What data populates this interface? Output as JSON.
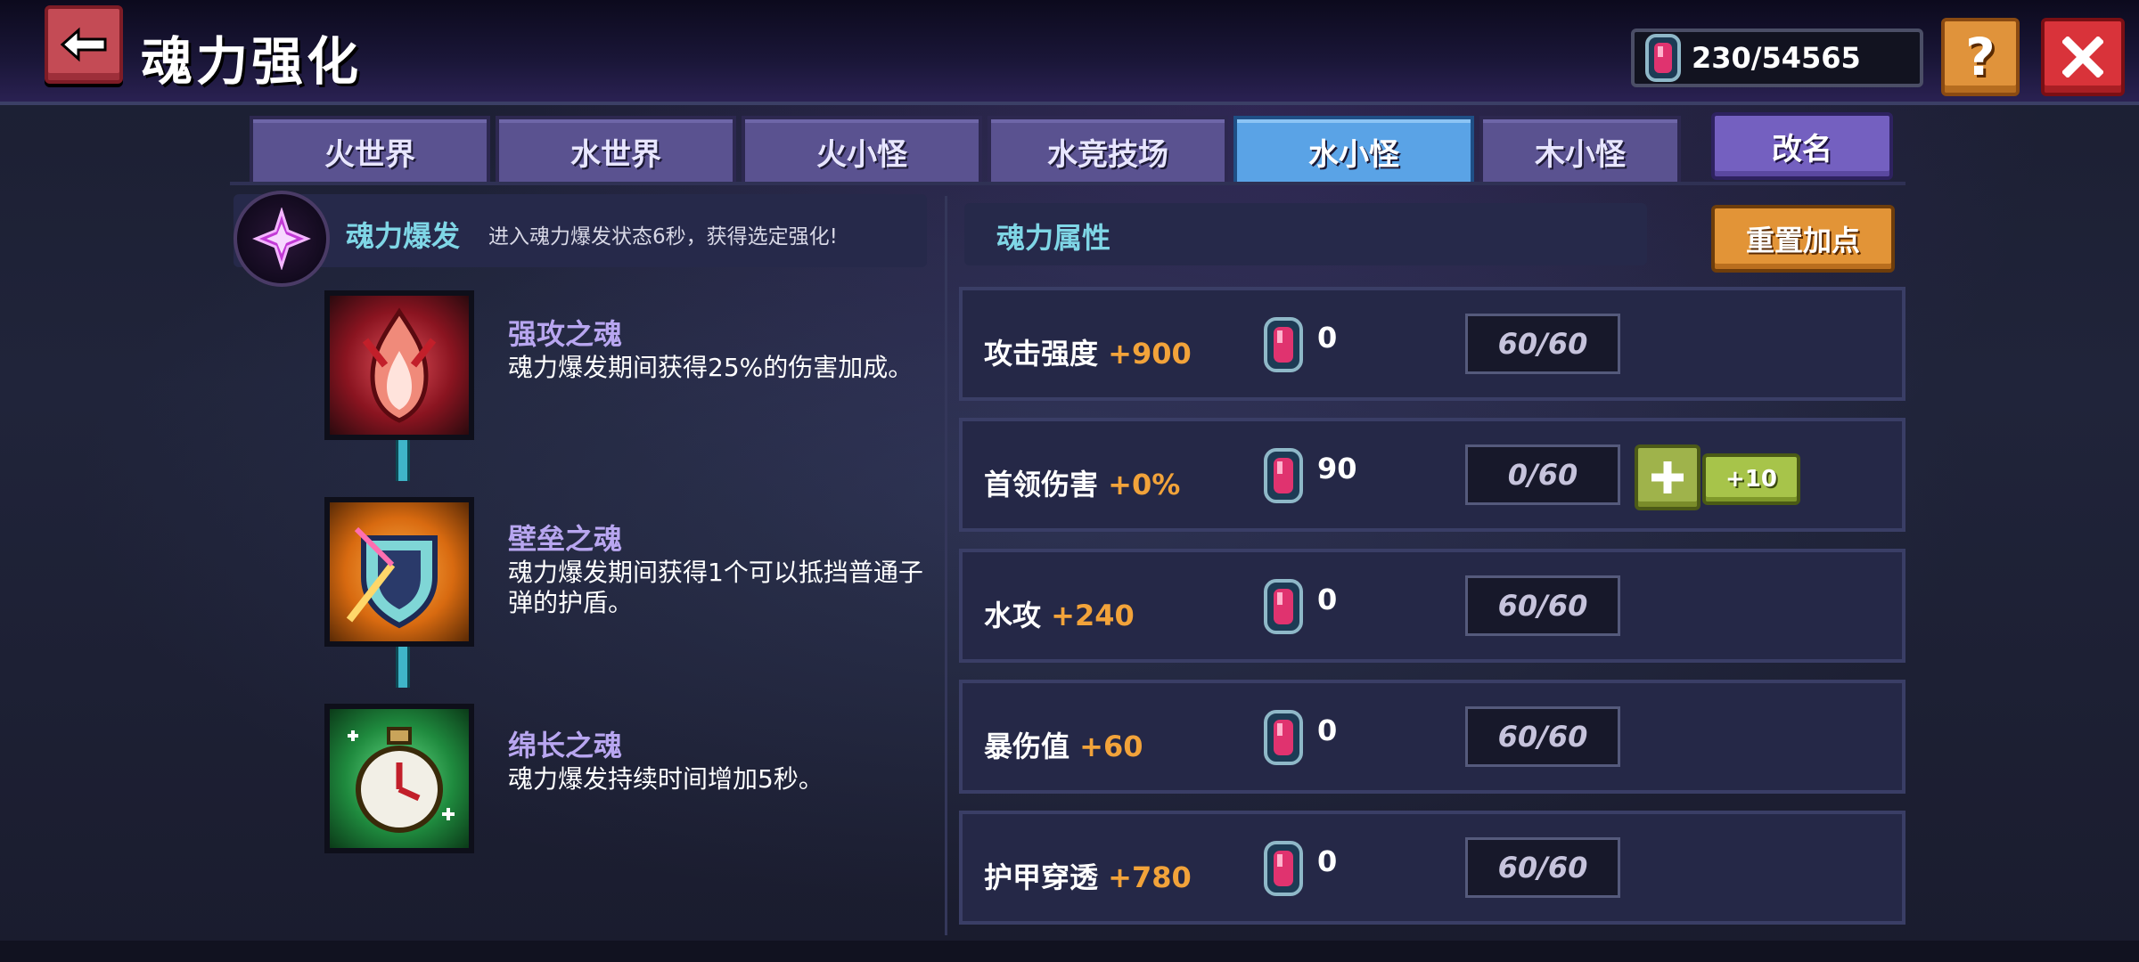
{
  "header": {
    "title": "魂力强化",
    "currency": "230/54565"
  },
  "tabs": [
    {
      "label": "火世界",
      "active": false
    },
    {
      "label": "水世界",
      "active": false
    },
    {
      "label": "火小怪",
      "active": false
    },
    {
      "label": "水竞技场",
      "active": false
    },
    {
      "label": "水小怪",
      "active": true
    },
    {
      "label": "木小怪",
      "active": false
    }
  ],
  "rename_label": "改名",
  "burst": {
    "title": "魂力爆发",
    "desc": "进入魂力爆发状态6秒，获得选定强化!"
  },
  "skills": [
    {
      "name": "强攻之魂",
      "desc": "魂力爆发期间获得25%的伤害加成。",
      "icon": "red-flame-icon"
    },
    {
      "name": "壁垒之魂",
      "desc": "魂力爆发期间获得1个可以抵挡普通子弹的护盾。",
      "icon": "shield-icon"
    },
    {
      "name": "绵长之魂",
      "desc": "魂力爆发持续时间增加5秒。",
      "icon": "stopwatch-icon"
    }
  ],
  "attributes": {
    "title": "魂力属性",
    "reset_label": "重置加点",
    "rows": [
      {
        "label": "攻击强度",
        "bonus": "+900",
        "cost": "0",
        "progress": "60/60",
        "upgradable": false
      },
      {
        "label": "首领伤害",
        "bonus": "+0%",
        "cost": "90",
        "progress": "0/60",
        "upgradable": true,
        "plus10": "+10"
      },
      {
        "label": "水攻",
        "bonus": "+240",
        "cost": "0",
        "progress": "60/60",
        "upgradable": false
      },
      {
        "label": "暴伤值",
        "bonus": "+60",
        "cost": "0",
        "progress": "60/60",
        "upgradable": false
      },
      {
        "label": "护甲穿透",
        "bonus": "+780",
        "cost": "0",
        "progress": "60/60",
        "upgradable": false
      }
    ]
  }
}
